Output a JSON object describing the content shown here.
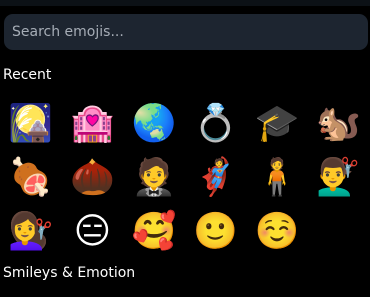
{
  "search": {
    "placeholder": "Search emojis..."
  },
  "sections": {
    "recent_label": "Recent",
    "smileys_label": "Smileys & Emotion"
  },
  "recent_emojis": [
    {
      "char": "🎑",
      "name": "moon-viewing-ceremony"
    },
    {
      "char": "🏩",
      "name": "love-hotel"
    },
    {
      "char": "🌏",
      "name": "globe-asia-australia"
    },
    {
      "char": "💍",
      "name": "ring"
    },
    {
      "char": "🎓",
      "name": "graduation-cap"
    },
    {
      "char": "🐿️",
      "name": "chipmunk"
    },
    {
      "char": "🍖",
      "name": "meat-on-bone"
    },
    {
      "char": "🌰",
      "name": "chestnut"
    },
    {
      "char": "🤵",
      "name": "person-in-tuxedo"
    },
    {
      "char": "🦸",
      "name": "superhero"
    },
    {
      "char": "🧍",
      "name": "person-standing"
    },
    {
      "char": "💇‍♂️",
      "name": "man-getting-haircut"
    },
    {
      "char": "💇‍♀️",
      "name": "woman-getting-haircut"
    },
    {
      "char": "😑",
      "name": "expressionless-face"
    },
    {
      "char": "🥰",
      "name": "smiling-face-with-hearts"
    },
    {
      "char": "🙂",
      "name": "slightly-smiling-face"
    },
    {
      "char": "☺️",
      "name": "smiling-face"
    }
  ]
}
